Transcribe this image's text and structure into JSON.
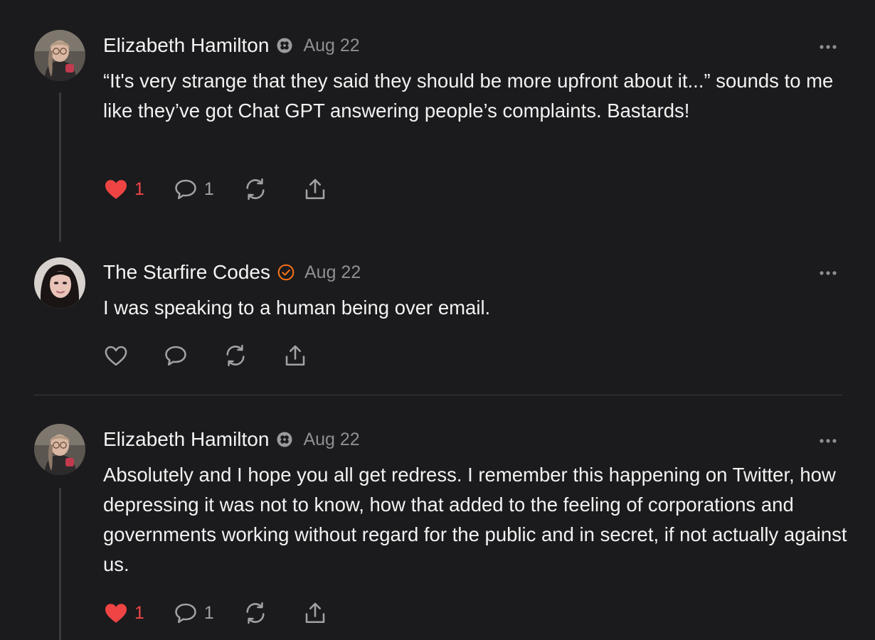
{
  "colors": {
    "background": "#1b1b1d",
    "like_active": "#ef4444",
    "verified_orange": "#f97316",
    "muted": "#8e8e93"
  },
  "posts": [
    {
      "author": "Elizabeth Hamilton",
      "badge_icon": "flower-badge-icon",
      "date": "Aug 22",
      "text": "“It's very strange that they said they should be more upfront about it...” sounds to me like they’ve got Chat GPT answering people’s complaints. Bastards!",
      "likes": "1",
      "comments": "1",
      "liked": true
    },
    {
      "author": "The Starfire Codes",
      "badge_icon": "verified-check-icon",
      "date": "Aug 22",
      "text": "I was speaking to a human being over email.",
      "likes": "",
      "comments": "",
      "liked": false
    },
    {
      "author": "Elizabeth Hamilton",
      "badge_icon": "flower-badge-icon",
      "date": "Aug 22",
      "text": "Absolutely and I hope you all get redress. I remember this happening on Twitter, how depressing it was not to know, how that added to the feeling of corporations and governments working without regard for the public and in secret, if not actually against us.",
      "likes": "1",
      "comments": "1",
      "liked": true
    }
  ]
}
